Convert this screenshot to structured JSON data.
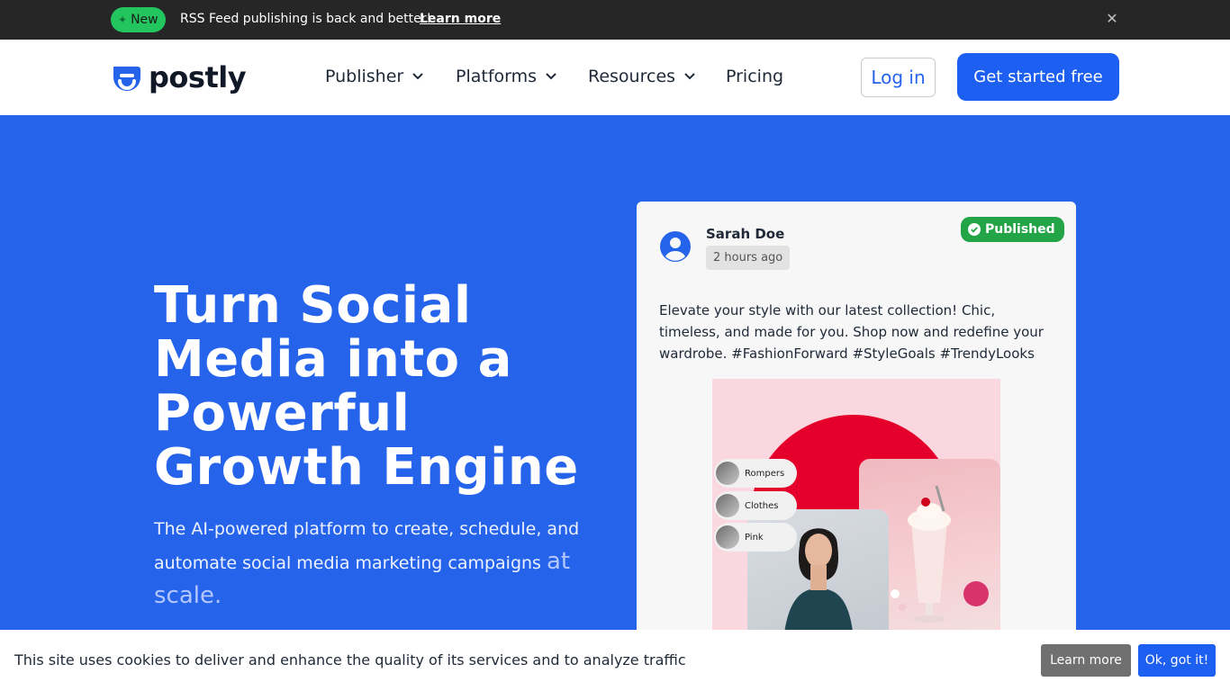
{
  "announcement": {
    "badge": "New",
    "badge_icon": "sparkle-icon",
    "text": "RSS Feed publishing is back and better!",
    "link": "Learn more",
    "close_icon": "close-icon"
  },
  "nav": {
    "logo_text": "postly",
    "items": [
      {
        "label": "Publisher",
        "has_dropdown": true
      },
      {
        "label": "Platforms",
        "has_dropdown": true
      },
      {
        "label": "Resources",
        "has_dropdown": true
      },
      {
        "label": "Pricing",
        "has_dropdown": false
      }
    ],
    "login": "Log in",
    "cta": "Get started free"
  },
  "hero": {
    "title": "Turn Social Media into a Powerful Growth Engine",
    "subtitle": "The AI-powered platform to create, schedule, and automate social media marketing campaigns",
    "subtitle_accent": "at scale."
  },
  "post_card": {
    "author": "Sarah Doe",
    "time": "2 hours ago",
    "status": "Published",
    "text": "Elevate your style with our latest collection! Chic, timeless, and made for you. Shop now and redefine your wardrobe.   #FashionForward #StyleGoals #TrendyLooks",
    "image_tags": [
      "Rompers",
      "Clothes",
      "Pink"
    ]
  },
  "cookie": {
    "text": "This site uses cookies to deliver and enhance the quality of its services and to analyze traffic",
    "learn": "Learn more",
    "ok": "Ok, got it!"
  },
  "colors": {
    "brand_blue": "#2563eb",
    "button_blue": "#1d5ff0",
    "announce_bg": "#262626",
    "new_badge": "#22c55e",
    "published_green": "#22a447",
    "image_red": "#e5002b",
    "image_pink": "#fbd7df"
  }
}
